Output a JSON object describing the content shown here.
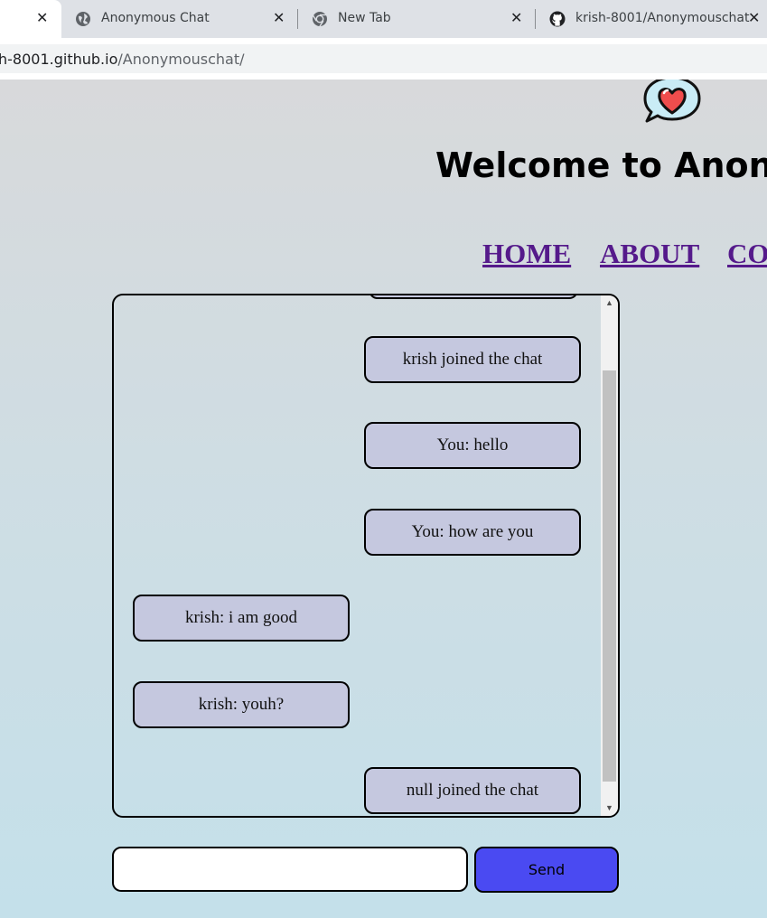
{
  "browser": {
    "tabs": [
      {
        "title": "",
        "active": true
      },
      {
        "title": "Anonymous Chat",
        "icon": "globe-icon"
      },
      {
        "title": "New Tab",
        "icon": "chrome-icon"
      },
      {
        "title": "krish-8001/Anonymouschat",
        "icon": "github-icon"
      }
    ],
    "close_glyph": "✕",
    "url_host": "h-8001.github.io",
    "url_path": "/Anonymouschat/"
  },
  "header": {
    "logo_icon": "chat-heart-icon",
    "title": "Welcome to Anonym"
  },
  "nav": {
    "home": "HOME",
    "about": "ABOUT",
    "contact": "CO"
  },
  "chat": {
    "messages": [
      {
        "text": "krish joined the chat",
        "side": "right"
      },
      {
        "text": "You: hello",
        "side": "right"
      },
      {
        "text": "You: how are you",
        "side": "right"
      },
      {
        "text": "krish: i am good",
        "side": "left"
      },
      {
        "text": "krish: youh?",
        "side": "left"
      },
      {
        "text": "null joined the chat",
        "side": "right"
      }
    ]
  },
  "composer": {
    "input_value": "",
    "send_label": "Send"
  },
  "colors": {
    "bubble": "#c5c8df",
    "send_button": "#4a4af2",
    "nav_link": "#551a8b"
  }
}
